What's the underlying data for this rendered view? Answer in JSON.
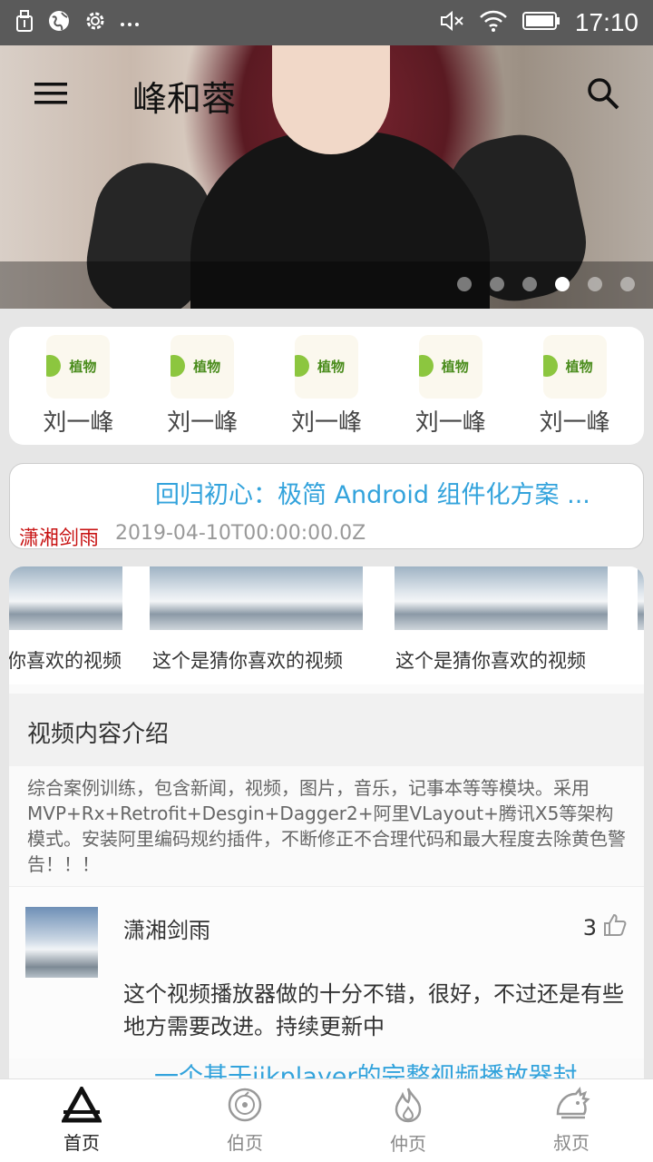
{
  "status_bar": {
    "time": "17:10",
    "left_icons": [
      "usb-icon",
      "globe-icon",
      "settings-icon",
      "more-icon"
    ],
    "right_icons": [
      "mute-icon",
      "wifi-icon",
      "battery-icon"
    ]
  },
  "header": {
    "title": "峰和蓉",
    "menu_icon": "hamburger-menu-icon",
    "search_icon": "search-icon"
  },
  "banner": {
    "dot_count": 6,
    "active_dot_index": 3
  },
  "quick_icons": {
    "items": [
      {
        "label": "刘一峰",
        "logo_text": "植物"
      },
      {
        "label": "刘一峰",
        "logo_text": "植物"
      },
      {
        "label": "刘一峰",
        "logo_text": "植物"
      },
      {
        "label": "刘一峰",
        "logo_text": "植物"
      },
      {
        "label": "刘一峰",
        "logo_text": "植物"
      }
    ]
  },
  "article": {
    "title": "回归初心：极简 Android 组件化方案 ...",
    "author": "潇湘剑雨",
    "date": "2019-04-10T00:00:00.0Z"
  },
  "video_card": {
    "thumb_labels": [
      "你喜欢的视频",
      "这个是猜你喜欢的视频",
      "这个是猜你喜欢的视频"
    ],
    "intro_heading": "视频内容介绍",
    "intro_text": "综合案例训练，包含新闻，视频，图片，音乐，记事本等等模块。采用MVP+Rx+Retrofit+Desgin+Dagger2+阿里VLayout+腾讯X5等架构模式。安装阿里编码规约插件，不断修正不合理代码和最大程度去除黄色警告！！！",
    "comment": {
      "name": "潇湘剑雨",
      "likes": "3",
      "text": "这个视频播放器做的十分不错，很好，不过还是有些地方需要改进。持续更新中"
    },
    "next_title": "一个基于ijkplayer的完整视频播放器封"
  },
  "tabs": [
    {
      "label": "首页",
      "icon": "triangle-home-icon",
      "active": true
    },
    {
      "label": "伯页",
      "icon": "disc-icon",
      "active": false
    },
    {
      "label": "仲页",
      "icon": "flame-icon",
      "active": false
    },
    {
      "label": "叔页",
      "icon": "hedgehog-icon",
      "active": false
    }
  ],
  "colors": {
    "accent_blue": "#33a3dc",
    "author_red": "#c81414",
    "status_bar": "#5a5a5a"
  }
}
